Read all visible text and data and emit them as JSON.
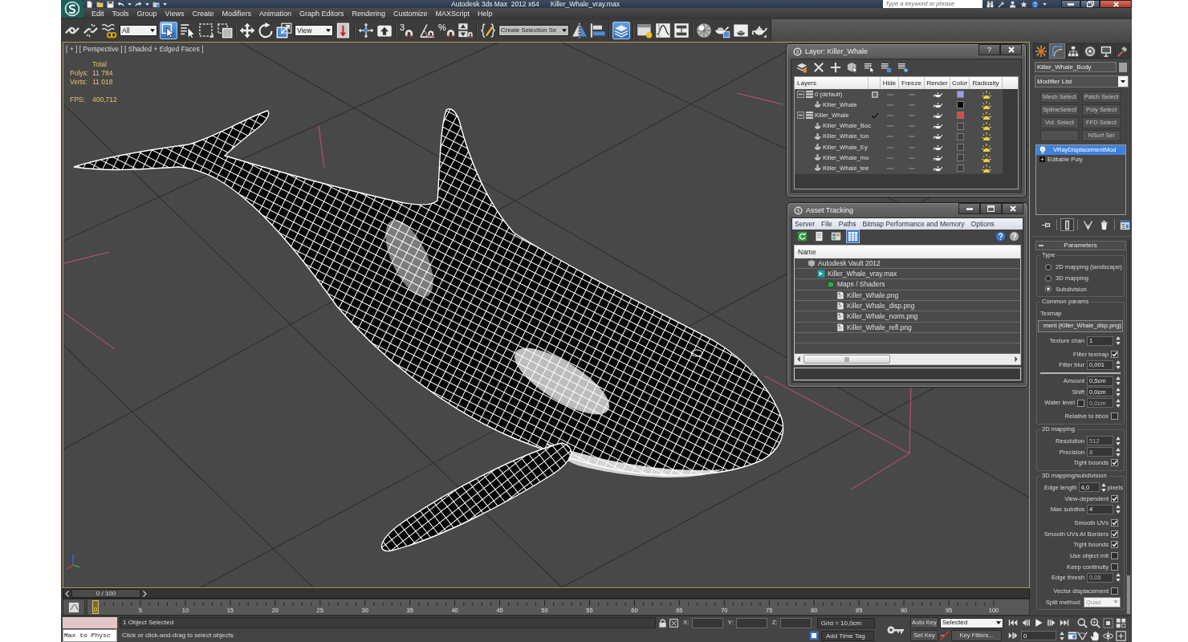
{
  "title_bar": {
    "app_title": "Autodesk 3ds Max  2012 x64",
    "file_name": "Killer_Whale_vray.max",
    "search": {
      "placeholder": "Type a keyword or phrase"
    }
  },
  "menu": [
    "Edit",
    "Tools",
    "Group",
    "Views",
    "Create",
    "Modifiers",
    "Animation",
    "Graph Editors",
    "Rendering",
    "Customize",
    "MAXScript",
    "Help"
  ],
  "toolbar": {
    "selection_filter": "All",
    "select_object": {
      "on": true
    },
    "reference_coordinate_system": "View",
    "snap_toggle": "3",
    "percent_snap": "%",
    "named_selection_set": "Create Selection Se",
    "layer_manager": {
      "on": true
    }
  },
  "viewport": {
    "active": true,
    "label": "[ + ] [ Perspective ] [ Shaded + Edged Faces ]",
    "stats": {
      "header": "Total",
      "rows": [
        {
          "label": "Polys:",
          "value": "11 784"
        },
        {
          "label": "Verts:",
          "value": "11 018"
        }
      ],
      "fps": {
        "label": "FPS:",
        "value": "400,712"
      }
    }
  },
  "layer_dialog": {
    "title": "Layer: Killer_Whale",
    "help": "?",
    "columns": [
      "Layers",
      "Hide",
      "Freeze",
      "Render",
      "Color",
      "Radiosity"
    ],
    "layers": [
      {
        "name": "0 (default)",
        "expanded": true,
        "current": false,
        "hidden": false,
        "frozen": false,
        "renderable": true,
        "color": "#9c9cf0",
        "radiosity": true,
        "children": [
          {
            "name": "Killer_Whale",
            "hidden": false,
            "frozen": false,
            "renderable": true,
            "color": "#000000",
            "radiosity": true
          }
        ]
      },
      {
        "name": "Killer_Whale",
        "expanded": true,
        "current": true,
        "hidden": false,
        "frozen": false,
        "renderable": true,
        "color": "#e04646",
        "radiosity": true,
        "children": [
          {
            "name": "Killer_Whale_Boc",
            "hidden": false,
            "frozen": false,
            "renderable": true,
            "color": "#404040",
            "radiosity": true
          },
          {
            "name": "Killer_Whale_ton",
            "hidden": false,
            "frozen": false,
            "renderable": true,
            "color": "#404040",
            "radiosity": true
          },
          {
            "name": "Killer_Whale_Ey",
            "hidden": false,
            "frozen": false,
            "renderable": true,
            "color": "#404040",
            "radiosity": true
          },
          {
            "name": "Killer_Whale_mo",
            "hidden": false,
            "frozen": false,
            "renderable": true,
            "color": "#404040",
            "radiosity": true
          },
          {
            "name": "Killer_Whale_tee",
            "hidden": false,
            "frozen": false,
            "renderable": true,
            "color": "#404040",
            "radiosity": true
          }
        ]
      }
    ]
  },
  "asset_tracking": {
    "title": "Asset Tracking",
    "menu": [
      "Server",
      "File",
      "Paths",
      "Bitmap Performance and Memory",
      "Options"
    ],
    "toolbar": [
      {
        "on": false
      },
      {
        "on": false
      },
      {
        "on": false
      },
      {
        "on": true
      }
    ],
    "column": "Name",
    "tree": [
      {
        "name": "Autodesk Vault 2012",
        "kind": "vault",
        "children": [
          {
            "name": "Killer_Whale_vray.max",
            "kind": "scene",
            "children": [
              {
                "name": "Maps / Shaders",
                "kind": "folder",
                "children": [
                  {
                    "name": "Killer_Whale.png",
                    "kind": "bitmap"
                  },
                  {
                    "name": "Killer_Whale_disp.png",
                    "kind": "bitmap"
                  },
                  {
                    "name": "Killer_Whale_norm.png",
                    "kind": "bitmap"
                  },
                  {
                    "name": "Killer_Whale_refl.png",
                    "kind": "bitmap"
                  }
                ]
              }
            ]
          }
        ]
      }
    ]
  },
  "command_panel": {
    "tabs": [
      {
        "selected": false
      },
      {
        "selected": true
      },
      {
        "selected": false
      },
      {
        "selected": false
      },
      {
        "selected": false
      },
      {
        "selected": false
      }
    ],
    "object_name": "Killer_Whale_Body",
    "modifier_list": "Modifier List",
    "modifier_buttons": [
      {
        "kind": "button",
        "label": "Mesh Select"
      },
      {
        "kind": "button",
        "label": "Patch Select"
      },
      {
        "kind": "button",
        "label": "SplineSelect"
      },
      {
        "kind": "button",
        "label": "Poly Select"
      },
      {
        "kind": "button",
        "label": "Vol. Select"
      },
      {
        "kind": "button",
        "label": "FFD Select"
      },
      {
        "kind": "blank"
      },
      {
        "kind": "button",
        "label": "NSurf Sel"
      }
    ],
    "stack": [
      {
        "name": "VRayDisplacementMod",
        "kind": "modifier",
        "selected": true
      },
      {
        "name": "Editable Poly",
        "kind": "object",
        "selected": false
      }
    ],
    "stack_tools": [
      {
        "on": false
      },
      {
        "on": true
      },
      {
        "on": false
      },
      {
        "on": false
      },
      {
        "on": false
      }
    ],
    "rollout": {
      "title": "Parameters",
      "expanded": true,
      "groups": [
        {
          "title": "Type",
          "rows": [
            {
              "kind": "radio",
              "label": "2D mapping (landscape)",
              "selected": false
            },
            {
              "kind": "radio",
              "label": "3D mapping",
              "selected": false
            },
            {
              "kind": "radio",
              "label": "Subdivision",
              "selected": true
            }
          ]
        },
        {
          "title": "Common params",
          "rows": [
            {
              "kind": "label",
              "label": "Texmap"
            },
            {
              "kind": "map_button",
              "label": "ment (Killer_Whale_disp.png)"
            },
            {
              "kind": "spinner",
              "label": "Texture chan",
              "value": "1",
              "disabled": false
            },
            {
              "kind": "checkbox",
              "label": "Filter texmap",
              "checked": true
            },
            {
              "kind": "spinner",
              "label": "Filter blur",
              "value": "0,001",
              "disabled": false
            },
            {
              "kind": "rule"
            },
            {
              "kind": "spinner",
              "label": "Amount",
              "value": "0,5cm",
              "disabled": false
            },
            {
              "kind": "spinner",
              "label": "Shift",
              "value": "0,0cm",
              "disabled": false
            },
            {
              "kind": "check_spinner",
              "label": "Water level",
              "checked": false,
              "value": "0,0cm",
              "disabled": true
            },
            {
              "kind": "checkbox",
              "label": "Relative to bbox",
              "checked": false
            }
          ]
        },
        {
          "title": "2D mapping",
          "rows": [
            {
              "kind": "spinner",
              "label": "Resolution",
              "value": "512",
              "disabled": true
            },
            {
              "kind": "spinner",
              "label": "Precision",
              "value": "8",
              "disabled": true
            },
            {
              "kind": "checkbox",
              "label": "Tight bounds",
              "checked": true
            }
          ]
        },
        {
          "title": "3D mapping/subdivision",
          "rows": [
            {
              "kind": "spinner",
              "label": "Edge length",
              "value": "4,0",
              "unit": "pixels",
              "disabled": false
            },
            {
              "kind": "checkbox",
              "label": "View-dependent",
              "checked": true
            },
            {
              "kind": "spinner",
              "label": "Max subdivs",
              "value": "4",
              "disabled": false
            },
            {
              "kind": "checkbox",
              "label": "Smooth UVs",
              "checked": true
            },
            {
              "kind": "checkbox",
              "label": "Smooth UVs At Borders",
              "checked": true
            },
            {
              "kind": "checkbox",
              "label": "Tight bounds",
              "checked": true
            },
            {
              "kind": "checkbox",
              "label": "Use object mtl",
              "checked": false
            },
            {
              "kind": "checkbox",
              "label": "Keep continuity",
              "checked": false
            },
            {
              "kind": "spinner",
              "label": "Edge thresh",
              "value": "0,05",
              "disabled": true
            },
            {
              "kind": "checkbox",
              "label": "Vector displacement",
              "checked": false
            },
            {
              "kind": "dropdown",
              "label": "Split method:",
              "value": "Quad",
              "disabled": true
            }
          ]
        }
      ]
    }
  },
  "time_slider": {
    "position": "0 / 100",
    "level": 0,
    "ticks": [
      "0",
      "5",
      "10",
      "15",
      "20",
      "25",
      "30",
      "35",
      "40",
      "45",
      "50",
      "55",
      "60",
      "65",
      "70",
      "75",
      "80",
      "85",
      "90",
      "95",
      "100"
    ]
  },
  "status_bar": {
    "listener_input": "Max to Physc",
    "selection_info": "1 Object Selected",
    "prompt": "Click or click-and-drag to select objects",
    "coordinates": [
      {
        "axis": "X:"
      },
      {
        "axis": "Y:"
      },
      {
        "axis": "Z:"
      }
    ],
    "grid": "Grid = 10,0cm",
    "time_tag": "Add Time Tag",
    "auto_key": {
      "label": "Auto Key",
      "on": false
    },
    "key_set": "Selected",
    "set_key": "Set Key",
    "key_filters": "Key Filters...",
    "current_frame": "0"
  }
}
